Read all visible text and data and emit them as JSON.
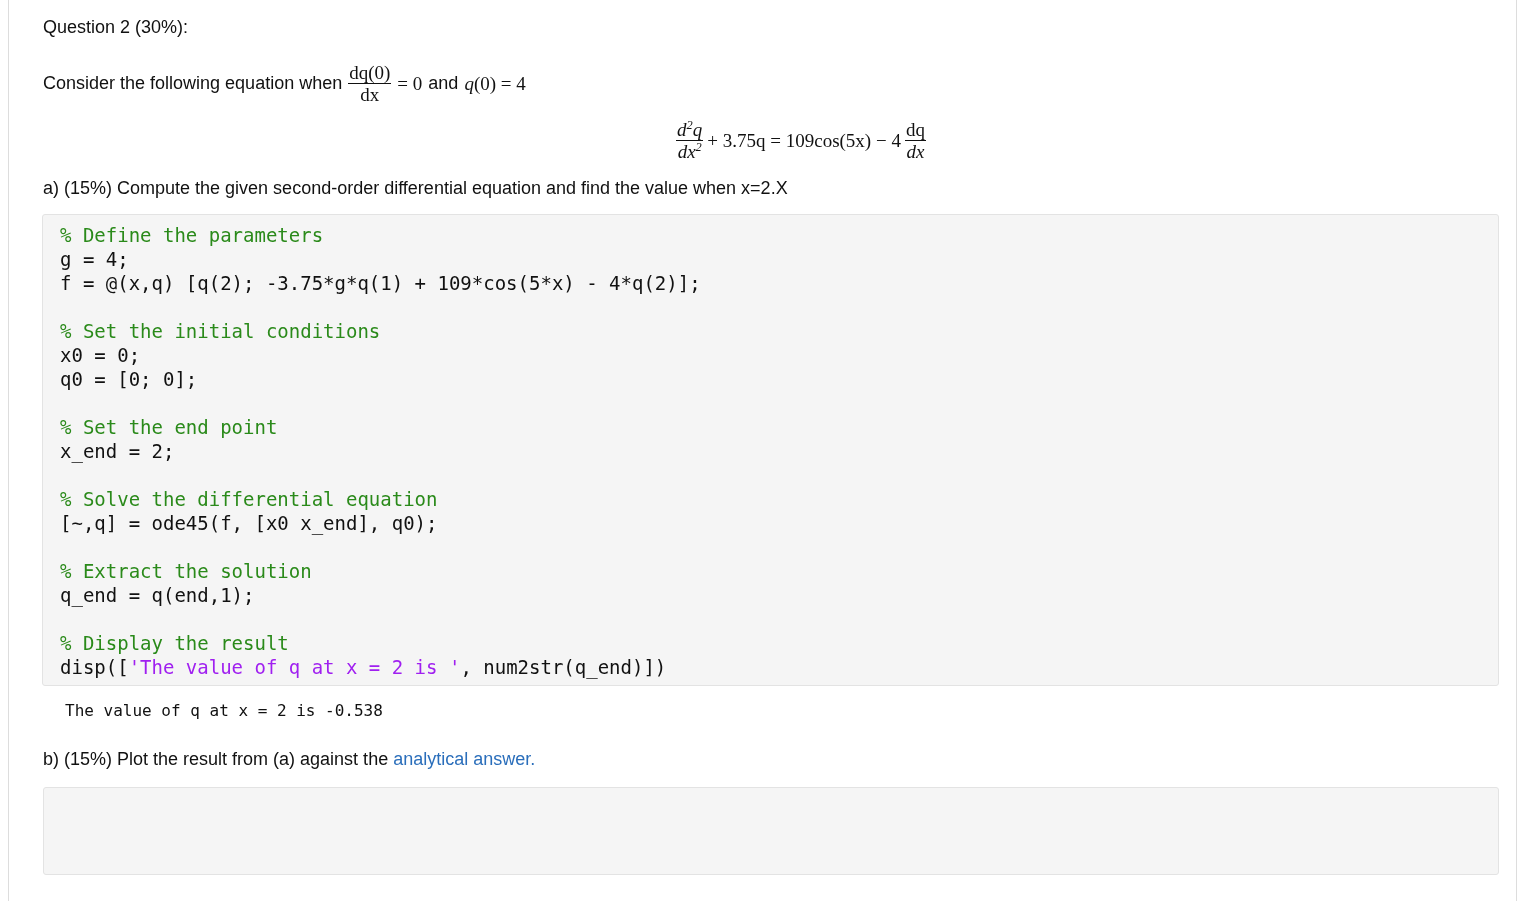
{
  "question_title": "Question 2 (30%):",
  "intro": {
    "text": "Consider the following equation when",
    "condition_1": {
      "numerator": "dq(0)",
      "denominator": "dx",
      "rhs": "= 0"
    },
    "joiner": "and",
    "condition_2": "*q*(0) = 4"
  },
  "equation": {
    "lhs_fraction": {
      "numerator": "d$^{2}$q",
      "denominator": "dx$^{2}$"
    },
    "middle": "+ 3.75q = 109cos(5x) − 4",
    "rhs_fraction": {
      "numerator": "dq",
      "denominator": "dx"
    }
  },
  "part_a": {
    "prompt": "a) (15%) Compute the given second-order differential equation and find the value when x=2.X",
    "code_blocks": [
      [
        [
          {
            "kind": "comment",
            "text": "% Define the parameters"
          }
        ],
        [
          {
            "kind": "plain",
            "text": "g = 4;"
          }
        ],
        [
          {
            "kind": "plain",
            "text": "f = @(x,q) [q(2); -3.75*g*q(1) + 109*cos(5*x) - 4*q(2)];"
          }
        ]
      ],
      [
        [
          {
            "kind": "comment",
            "text": "% Set the initial conditions"
          }
        ],
        [
          {
            "kind": "plain",
            "text": "x0 = 0;"
          }
        ],
        [
          {
            "kind": "plain",
            "text": "q0 = [0; 0];"
          }
        ]
      ],
      [
        [
          {
            "kind": "comment",
            "text": "% Set the end point"
          }
        ],
        [
          {
            "kind": "plain",
            "text": "x_end = 2;"
          }
        ]
      ],
      [
        [
          {
            "kind": "comment",
            "text": "% Solve the differential equation"
          }
        ],
        [
          {
            "kind": "plain",
            "text": "[~,q] = ode45(f, [x0 x_end], q0);"
          }
        ]
      ],
      [
        [
          {
            "kind": "comment",
            "text": "% Extract the solution"
          }
        ],
        [
          {
            "kind": "plain",
            "text": "q_end = q(end,1);"
          }
        ]
      ],
      [
        [
          {
            "kind": "comment",
            "text": "% Display the result"
          }
        ],
        [
          {
            "kind": "plain",
            "text": "disp(["
          },
          {
            "kind": "string",
            "text": "'The value of q at x = 2 is '"
          },
          {
            "kind": "plain",
            "text": ", num2str(q_end)])"
          }
        ]
      ]
    ],
    "output": "The value of q at x = 2 is -0.538"
  },
  "part_b": {
    "prompt": "b) (15%) Plot the result from (a) against the",
    "link": "analytical answer."
  }
}
